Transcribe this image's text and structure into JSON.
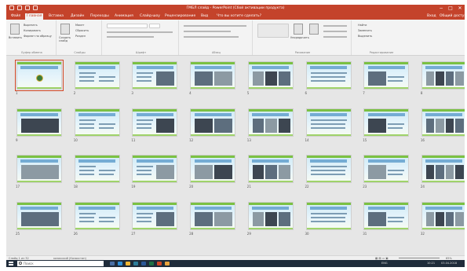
{
  "window": {
    "title": "ГМБЛ слайд - PowerPoint (Сбой активации продукта)",
    "minimize_glyph": "−",
    "restore_glyph": "□",
    "close_glyph": "✕"
  },
  "ribbon_tabs": {
    "file": "Файл",
    "home": "Главная",
    "insert": "Вставка",
    "design": "Дизайн",
    "transitions": "Переходы",
    "animations": "Анимация",
    "slideshow": "Слайд-шоу",
    "review": "Рецензирование",
    "view": "Вид",
    "tellme": "Что вы хотите сделать?",
    "signin": "Вход",
    "share": "Общий доступ"
  },
  "ribbon_groups": {
    "clipboard": "Буфер обмена",
    "slides": "Слайды",
    "font": "Шрифт",
    "paragraph": "Абзац",
    "drawing": "Рисование",
    "editing": "Редактирование",
    "paste": "Вставить",
    "cut": "Вырезать",
    "copy": "Копировать",
    "format_painter": "Формат по образцу",
    "new_slide": "Создать слайд",
    "layout": "Макет",
    "reset": "Сбросить",
    "section": "Раздел",
    "arrange": "Упорядочить",
    "find": "Найти",
    "replace": "Заменить",
    "select": "Выделить"
  },
  "slides": [
    {
      "number": "1"
    },
    {
      "number": "2"
    },
    {
      "number": "3"
    },
    {
      "number": "4"
    },
    {
      "number": "5"
    },
    {
      "number": "6"
    },
    {
      "number": "7"
    },
    {
      "number": "8"
    },
    {
      "number": "9"
    },
    {
      "number": "10"
    },
    {
      "number": "11"
    },
    {
      "number": "12"
    },
    {
      "number": "13"
    },
    {
      "number": "14"
    },
    {
      "number": "15"
    },
    {
      "number": "16"
    },
    {
      "number": "17"
    },
    {
      "number": "18"
    },
    {
      "number": "19"
    },
    {
      "number": "20"
    },
    {
      "number": "21"
    },
    {
      "number": "22"
    },
    {
      "number": "23"
    },
    {
      "number": "24"
    },
    {
      "number": "25"
    },
    {
      "number": "26"
    },
    {
      "number": "27"
    },
    {
      "number": "28"
    },
    {
      "number": "29"
    },
    {
      "number": "30"
    },
    {
      "number": "31"
    },
    {
      "number": "32"
    }
  ],
  "selected_slide": 1,
  "status": {
    "slide_info": "Слайд 1 из 32",
    "language": "казахский (Казахстан)",
    "zoom": "65%"
  },
  "taskbar": {
    "search_placeholder": "Поиск",
    "tray_lang": "ENG",
    "time": "10:21",
    "date": "03.04.2018"
  },
  "colors": {
    "accent": "#c4432b",
    "selection": "#d24726",
    "slide_header": "#7bc143",
    "taskbar": "#1f2b3a"
  }
}
